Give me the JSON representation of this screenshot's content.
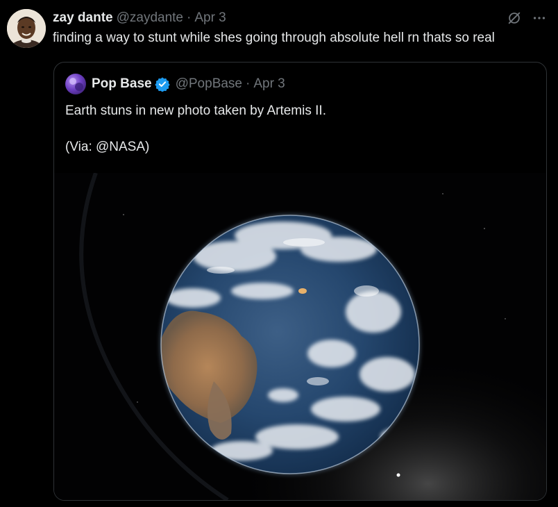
{
  "tweet": {
    "author_name": "zay dante",
    "author_handle": "@zaydante",
    "separator": "·",
    "date": "Apr 3",
    "text": "finding a way to stunt while shes going through absolute hell rn thats so real",
    "icons": {
      "grok": "grok-icon",
      "more": "more-options-icon"
    }
  },
  "quoted_tweet": {
    "author_name": "Pop Base",
    "verified": true,
    "author_handle": "@PopBase",
    "separator": "·",
    "date": "Apr 3",
    "text_line_1": "Earth stuns in new photo taken by Artemis II.",
    "text_line_2": "(Via: @NASA)",
    "media": "earth-from-space-photo"
  },
  "colors": {
    "background": "#000000",
    "text_primary": "#e7e9ea",
    "text_secondary": "#71767b",
    "border": "#2f3336",
    "verified_blue": "#1d9bf0"
  }
}
